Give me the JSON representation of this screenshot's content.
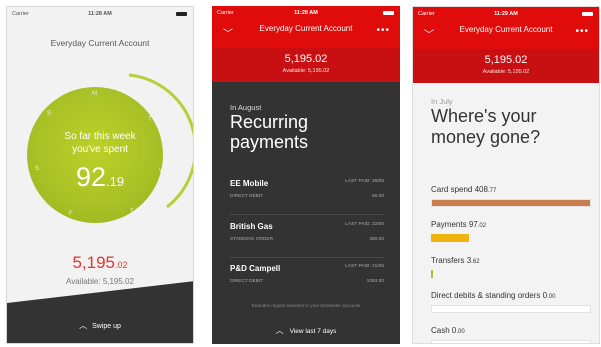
{
  "screen_everyday": {
    "status": {
      "carrier": "Carrier",
      "time": "11:28 AM"
    },
    "account_title": "Everyday Current Account",
    "days": [
      "M",
      "T",
      "W",
      "T",
      "F",
      "S",
      "S"
    ],
    "so_far_line1": "So far this week",
    "so_far_line2": "you've spent",
    "spent_main": "92",
    "spent_dec": ".19",
    "balance_main": "5,195",
    "balance_dec": ".02",
    "available": "Available: 5,195.02",
    "swipe_label": "Swipe up",
    "colors": {
      "ring_green": "#a9c226",
      "balance_red": "#e5352c"
    }
  },
  "screen_recurring": {
    "status": {
      "carrier": "Carrier",
      "time": "11:28 AM"
    },
    "header": {
      "title": "Everyday Current Account",
      "balance": "5,195.02",
      "available": "Available: 5,195.02"
    },
    "period": "In August",
    "heading": "Recurring payments",
    "payments": [
      {
        "name": "EE Mobile",
        "type": "DIRECT DEBIT",
        "last_paid": "LAST PAID: 28/05",
        "amount": "50.00"
      },
      {
        "name": "British Gas",
        "type": "STANDING ORDER",
        "last_paid": "LAST PAID: 22/05",
        "amount": "350.00"
      },
      {
        "name": "P&D Campell",
        "type": "DIRECT DEBIT",
        "last_paid": "LAST PAID: 21/05",
        "amount": "1083.00"
      }
    ],
    "note": "Excludes regular transfers to your Santander accounts",
    "view_label": "View last 7 days"
  },
  "screen_money": {
    "status": {
      "carrier": "Carrier",
      "time": "11:29 AM"
    },
    "header": {
      "title": "Everyday Current Account",
      "balance": "5,195.02",
      "available": "Available: 5,195.02"
    },
    "period": "In July",
    "heading": "Where's your money gone?",
    "categories": [
      {
        "label": "Card spend",
        "int": "408",
        "dec": ".77",
        "fraction": 1.0,
        "color": "#c97f4c"
      },
      {
        "label": "Payments",
        "int": "97",
        "dec": ".02",
        "fraction": 0.24,
        "color": "#f0b40f"
      },
      {
        "label": "Transfers",
        "int": "3",
        "dec": ".62",
        "fraction": 0.012,
        "color": "#a6c42a"
      },
      {
        "label": "Direct debits & standing orders",
        "int": "0",
        "dec": ".00",
        "fraction": 0,
        "color": "#cccccc"
      },
      {
        "label": "Cash",
        "int": "0",
        "dec": ".00",
        "fraction": 0,
        "color": "#cccccc"
      }
    ]
  }
}
